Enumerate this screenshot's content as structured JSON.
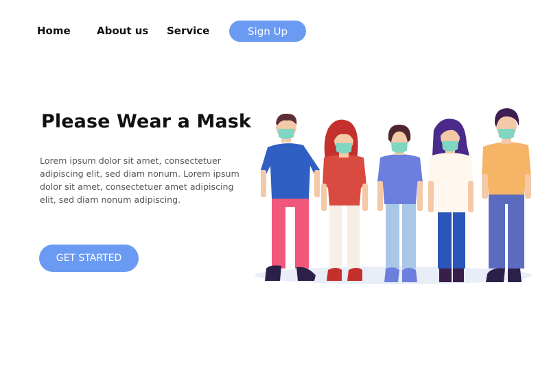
{
  "nav": {
    "home": "Home",
    "about": "About us",
    "service": "Service",
    "signup": "Sign Up"
  },
  "hero": {
    "title": "Please Wear a Mask",
    "body": "Lorem ipsum dolor sit amet, consectetuer adipiscing elit, sed diam nonum. Lorem ipsum dolor sit amet, consectetuer amet adipiscing elit, sed diam nonum adipiscing.",
    "cta": "GET STARTED"
  },
  "colors": {
    "accent": "#6b9af3",
    "mask": "#7fd6c2"
  }
}
